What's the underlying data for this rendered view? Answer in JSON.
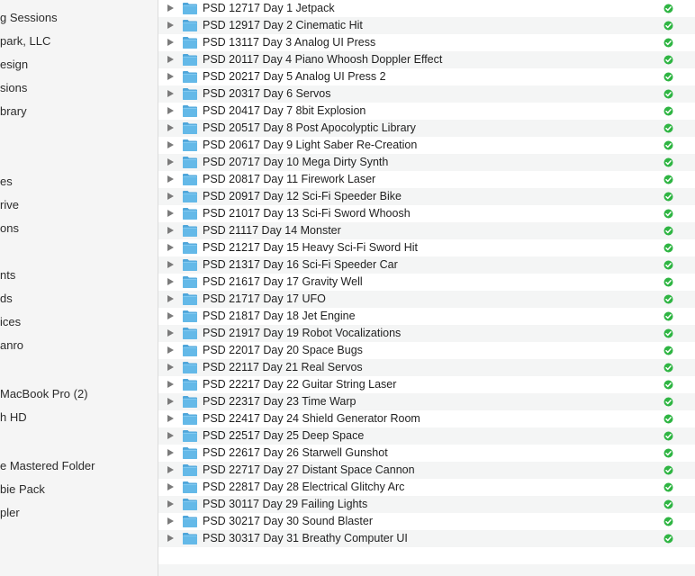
{
  "sidebar": {
    "items": [
      "g Sessions",
      "park, LLC",
      "esign",
      "sions",
      "brary",
      "es",
      "rive",
      "ons",
      "nts",
      "ds",
      "ices",
      "anro",
      "MacBook Pro (2)",
      "h HD",
      "e Mastered Folder",
      "bie Pack",
      "pler"
    ]
  },
  "folders": [
    "PSD 12717 Day 1 Jetpack",
    "PSD 12917 Day 2 Cinematic Hit",
    "PSD 13117 Day 3 Analog UI Press",
    "PSD 20117 Day 4 Piano Whoosh Doppler Effect",
    "PSD 20217 Day 5 Analog UI Press 2",
    "PSD 20317 Day 6 Servos",
    "PSD 20417 Day 7 8bit Explosion",
    "PSD 20517 Day 8 Post Apocolyptic Library",
    "PSD 20617 Day 9 Light Saber Re-Creation",
    "PSD 20717 Day 10 Mega Dirty Synth",
    "PSD 20817 Day 11 Firework Laser",
    "PSD 20917 Day 12 Sci-Fi Speeder Bike",
    "PSD 21017 Day 13 Sci-Fi Sword Whoosh",
    "PSD 21117 Day 14 Monster",
    "PSD 21217 Day 15 Heavy Sci-Fi Sword Hit",
    "PSD 21317 Day 16 Sci-Fi Speeder Car",
    "PSD 21617 Day 17 Gravity Well",
    "PSD 21717 Day 17 UFO",
    "PSD 21817 Day 18 Jet Engine",
    "PSD 21917 Day 19 Robot Vocalizations",
    "PSD 22017 Day 20 Space Bugs",
    "PSD 22117 Day 21 Real Servos",
    "PSD 22217 Day 22 Guitar String Laser",
    "PSD 22317 Day 23 Time Warp",
    "PSD 22417 Day 24 Shield Generator Room",
    "PSD 22517 Day 25 Deep Space",
    "PSD 22617 Day 26 Starwell Gunshot",
    "PSD 22717 Day 27 Distant Space Cannon",
    "PSD 22817 Day 28 Electrical Glitchy Arc",
    "PSD 30117 Day 29 Failing Lights",
    "PSD 30217 Day 30 Sound Blaster",
    "PSD 30317 Day 31 Breathy Computer UI"
  ],
  "icons": {
    "disclosure": "disclosure-triangle-icon",
    "folder": "folder-icon",
    "status": "synced-checkmark-icon"
  },
  "colors": {
    "folder_blue": "#64b9e8",
    "status_green": "#2fb543",
    "row_alt": "#f4f5f5",
    "sidebar_bg": "#f5f5f5"
  }
}
